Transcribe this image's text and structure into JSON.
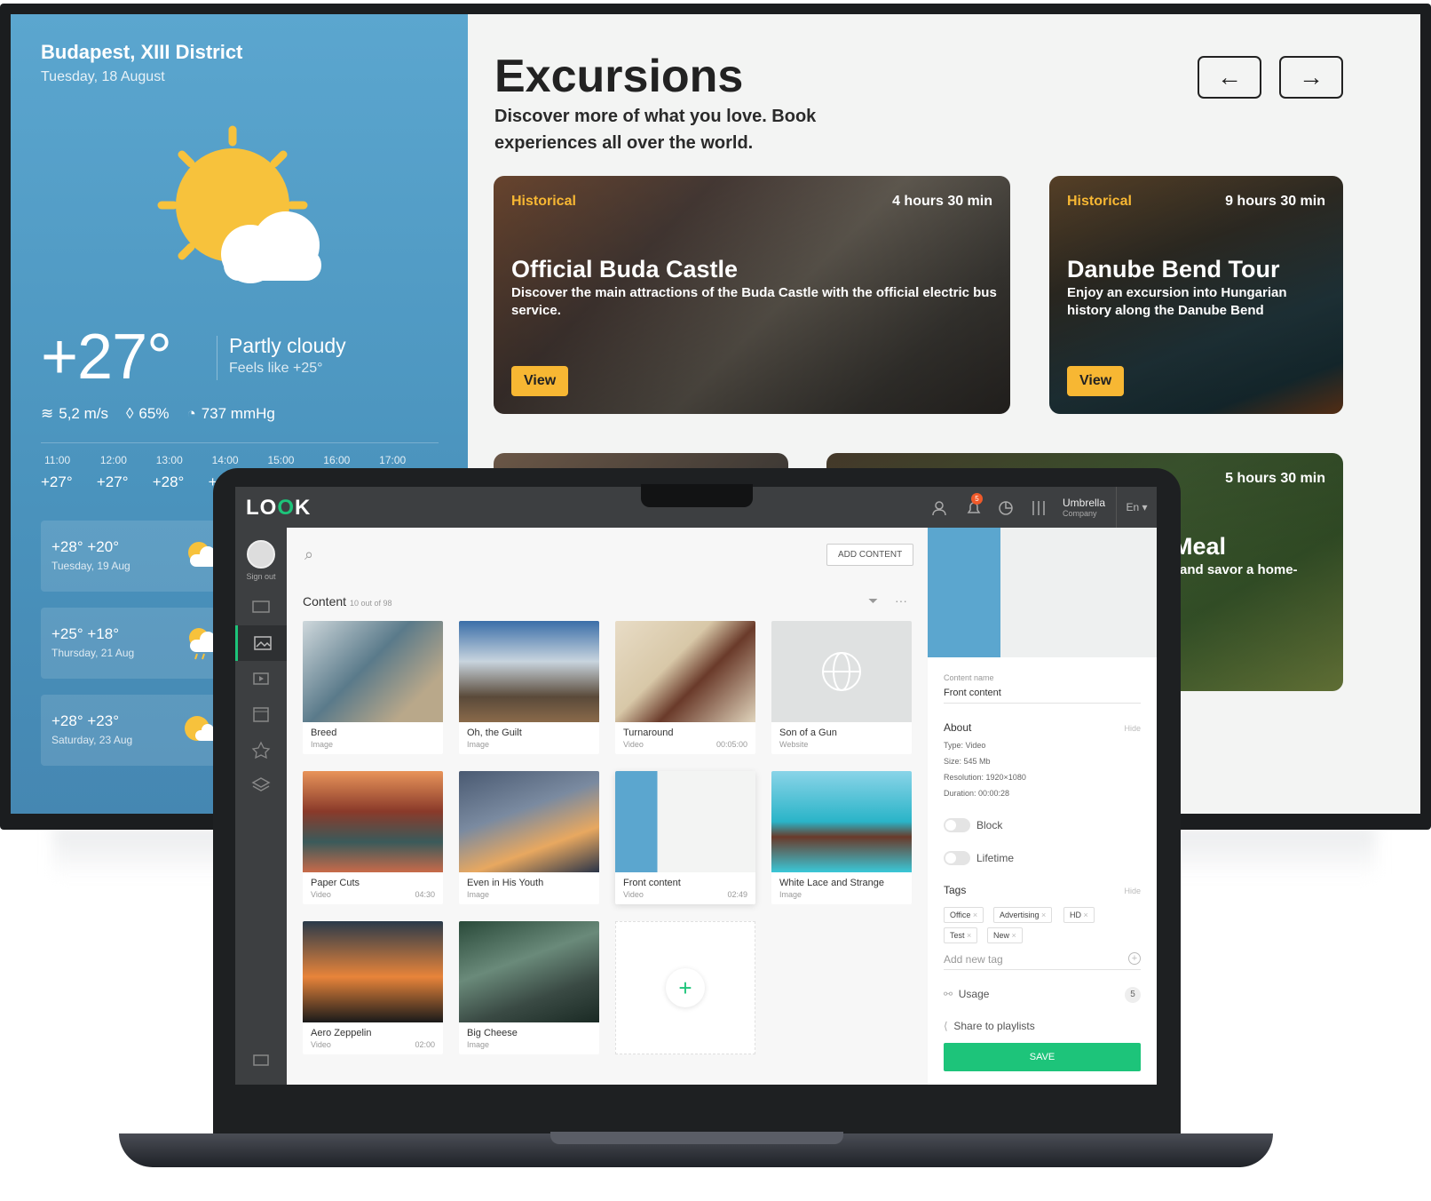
{
  "weather": {
    "city": "Budapest, XIII District",
    "date": "Tuesday, 18 August",
    "temperature": "+27°",
    "condition": "Partly cloudy",
    "feels_like": "Feels like +25°",
    "wind": "5,2 m/s",
    "humidity": "65%",
    "pressure": "737 mmHg",
    "hourly": [
      {
        "time": "11:00",
        "temp": "+27°"
      },
      {
        "time": "12:00",
        "temp": "+27°"
      },
      {
        "time": "13:00",
        "temp": "+28°"
      },
      {
        "time": "14:00",
        "temp": "+"
      },
      {
        "time": "15:00",
        "temp": ""
      },
      {
        "time": "16:00",
        "temp": ""
      },
      {
        "time": "17:00",
        "temp": ""
      }
    ],
    "daily": [
      {
        "range": "+28° +20°",
        "date": "Tuesday, 19 Aug"
      },
      {
        "range": "+25° +18°",
        "date": "Thursday, 21 Aug"
      },
      {
        "range": "+28° +23°",
        "date": "Saturday, 23 Aug"
      }
    ]
  },
  "excursions": {
    "title": "Excursions",
    "subtitle": "Discover more of what you love. Book experiences all over the world.",
    "prev_icon": "arrow-left-icon",
    "next_icon": "arrow-right-icon",
    "cards": [
      {
        "category": "Historical",
        "duration": "4 hours 30 min",
        "title": "Official Buda Castle",
        "description": "Discover the main attractions of the Buda Castle with the official electric bus service.",
        "button": "View"
      },
      {
        "category": "Historical",
        "duration": "9 hours 30 min",
        "title": "Danube Bend Tour",
        "description": "Enjoy an excursion into Hungarian history along the Danube Bend",
        "button": "View"
      },
      {
        "duration": "5 hours 30 min",
        "title": "Meal",
        "description": "and savor a home-"
      }
    ]
  },
  "app": {
    "logo": "LOOK",
    "badge_count": "5",
    "company_name": "Umbrella",
    "company_sub": "Company",
    "language": "En",
    "sign_out": "Sign out",
    "add_content": "ADD CONTENT",
    "content_title": "Content",
    "content_count": "10 out of 98",
    "items": [
      {
        "name": "Breed",
        "kind": "Image",
        "duration": ""
      },
      {
        "name": "Oh, the Guilt",
        "kind": "Image",
        "duration": ""
      },
      {
        "name": "Turnaround",
        "kind": "Video",
        "duration": "00:05:00"
      },
      {
        "name": "Son of a Gun",
        "kind": "Website",
        "duration": ""
      },
      {
        "name": "Paper Cuts",
        "kind": "Video",
        "duration": "04:30"
      },
      {
        "name": "Even in His Youth",
        "kind": "Image",
        "duration": ""
      },
      {
        "name": "Front content",
        "kind": "Video",
        "duration": "02:49"
      },
      {
        "name": "White Lace and Strange",
        "kind": "Image",
        "duration": ""
      },
      {
        "name": "Aero Zeppelin",
        "kind": "Video",
        "duration": "02:00"
      },
      {
        "name": "Big Cheese",
        "kind": "Image",
        "duration": ""
      }
    ],
    "details": {
      "name_label": "Content name",
      "name_value": "Front content",
      "about": "About",
      "hide": "Hide",
      "type": "Type: Video",
      "size": "Size: 545 Mb",
      "resolution": "Resolution: 1920×1080",
      "duration": "Duration: 00:00:28",
      "block": "Block",
      "lifetime": "Lifetime",
      "tags_label": "Tags",
      "tags": [
        "Office",
        "Advertising",
        "HD",
        "Test",
        "New"
      ],
      "add_tag": "Add new tag",
      "usage": "Usage",
      "usage_count": "5",
      "share": "Share to playlists",
      "save": "SAVE"
    }
  }
}
